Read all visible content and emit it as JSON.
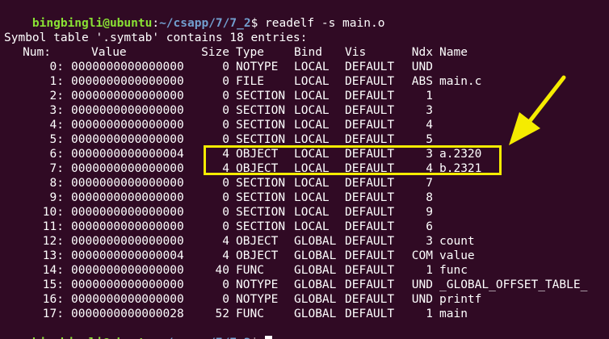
{
  "prompt": {
    "user_host": "bingbingli@ubuntu",
    "colon": ":",
    "path": "~/csapp/7/7_2",
    "dollar": "$",
    "command": " readelf -s main.o"
  },
  "symtab_title": "Symbol table '.symtab' contains 18 entries:",
  "headers": {
    "num": "Num:",
    "value": "Value",
    "size": "Size",
    "type": "Type",
    "bind": "Bind",
    "vis": "Vis",
    "ndx": "Ndx",
    "name": "Name"
  },
  "rows": [
    {
      "num": "0:",
      "value": "0000000000000000",
      "size": "0",
      "type": "NOTYPE",
      "bind": "LOCAL",
      "vis": "DEFAULT",
      "ndx": "UND",
      "name": ""
    },
    {
      "num": "1:",
      "value": "0000000000000000",
      "size": "0",
      "type": "FILE",
      "bind": "LOCAL",
      "vis": "DEFAULT",
      "ndx": "ABS",
      "name": "main.c"
    },
    {
      "num": "2:",
      "value": "0000000000000000",
      "size": "0",
      "type": "SECTION",
      "bind": "LOCAL",
      "vis": "DEFAULT",
      "ndx": "1",
      "name": ""
    },
    {
      "num": "3:",
      "value": "0000000000000000",
      "size": "0",
      "type": "SECTION",
      "bind": "LOCAL",
      "vis": "DEFAULT",
      "ndx": "3",
      "name": ""
    },
    {
      "num": "4:",
      "value": "0000000000000000",
      "size": "0",
      "type": "SECTION",
      "bind": "LOCAL",
      "vis": "DEFAULT",
      "ndx": "4",
      "name": ""
    },
    {
      "num": "5:",
      "value": "0000000000000000",
      "size": "0",
      "type": "SECTION",
      "bind": "LOCAL",
      "vis": "DEFAULT",
      "ndx": "5",
      "name": ""
    },
    {
      "num": "6:",
      "value": "0000000000000004",
      "size": "4",
      "type": "OBJECT",
      "bind": "LOCAL",
      "vis": "DEFAULT",
      "ndx": "3",
      "name": "a.2320"
    },
    {
      "num": "7:",
      "value": "0000000000000000",
      "size": "4",
      "type": "OBJECT",
      "bind": "LOCAL",
      "vis": "DEFAULT",
      "ndx": "4",
      "name": "b.2321"
    },
    {
      "num": "8:",
      "value": "0000000000000000",
      "size": "0",
      "type": "SECTION",
      "bind": "LOCAL",
      "vis": "DEFAULT",
      "ndx": "7",
      "name": ""
    },
    {
      "num": "9:",
      "value": "0000000000000000",
      "size": "0",
      "type": "SECTION",
      "bind": "LOCAL",
      "vis": "DEFAULT",
      "ndx": "8",
      "name": ""
    },
    {
      "num": "10:",
      "value": "0000000000000000",
      "size": "0",
      "type": "SECTION",
      "bind": "LOCAL",
      "vis": "DEFAULT",
      "ndx": "9",
      "name": ""
    },
    {
      "num": "11:",
      "value": "0000000000000000",
      "size": "0",
      "type": "SECTION",
      "bind": "LOCAL",
      "vis": "DEFAULT",
      "ndx": "6",
      "name": ""
    },
    {
      "num": "12:",
      "value": "0000000000000000",
      "size": "4",
      "type": "OBJECT",
      "bind": "GLOBAL",
      "vis": "DEFAULT",
      "ndx": "3",
      "name": "count"
    },
    {
      "num": "13:",
      "value": "0000000000000004",
      "size": "4",
      "type": "OBJECT",
      "bind": "GLOBAL",
      "vis": "DEFAULT",
      "ndx": "COM",
      "name": "value"
    },
    {
      "num": "14:",
      "value": "0000000000000000",
      "size": "40",
      "type": "FUNC",
      "bind": "GLOBAL",
      "vis": "DEFAULT",
      "ndx": "1",
      "name": "func"
    },
    {
      "num": "15:",
      "value": "0000000000000000",
      "size": "0",
      "type": "NOTYPE",
      "bind": "GLOBAL",
      "vis": "DEFAULT",
      "ndx": "UND",
      "name": "_GLOBAL_OFFSET_TABLE_"
    },
    {
      "num": "16:",
      "value": "0000000000000000",
      "size": "0",
      "type": "NOTYPE",
      "bind": "GLOBAL",
      "vis": "DEFAULT",
      "ndx": "UND",
      "name": "printf"
    },
    {
      "num": "17:",
      "value": "0000000000000028",
      "size": "52",
      "type": "FUNC",
      "bind": "GLOBAL",
      "vis": "DEFAULT",
      "ndx": "1",
      "name": "main"
    }
  ],
  "colors": {
    "background": "#300a24",
    "user_host": "#8ae234",
    "path": "#729fcf",
    "text": "#ffffff",
    "annotation": "#f5ec00"
  },
  "annotation": {
    "highlighted_rows": [
      "6:",
      "7:"
    ],
    "arrow_icon": "arrow-pointing-down-left"
  }
}
